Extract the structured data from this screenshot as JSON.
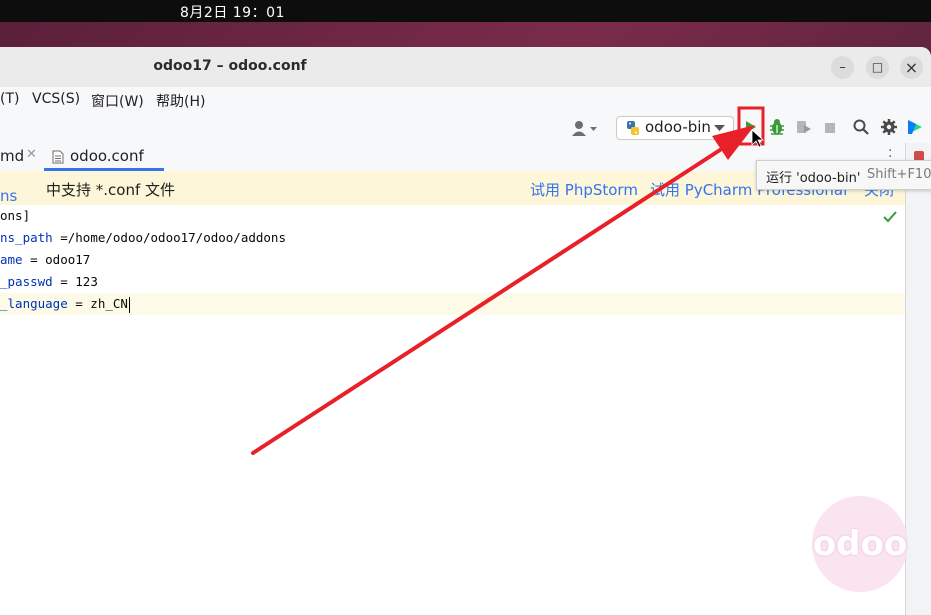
{
  "system": {
    "clock": "8月2日  19：01"
  },
  "window": {
    "title": "odoo17 – odoo.conf",
    "minimize": "–",
    "maximize": "□",
    "close": "×"
  },
  "menubar": {
    "items": [
      "(T)",
      "VCS(S)",
      "窗口(W)",
      "帮助(H)"
    ]
  },
  "toolbar": {
    "run_config": "odoo-bin"
  },
  "tabs": [
    {
      "label": "md"
    },
    {
      "label": "odoo.conf"
    }
  ],
  "banner": {
    "message_link": "ns IDE",
    "message": "中支持 *.conf 文件",
    "action1": "试用 PhpStorm",
    "action2": "试用 PyCharm Professional",
    "action3": "关闭"
  },
  "editor": {
    "lines": [
      {
        "key": "",
        "rest": "ons]"
      },
      {
        "key": "ns_path",
        "rest": " =/home/odoo/odoo17/odoo/addons"
      },
      {
        "key": "ame",
        "rest": " = odoo17"
      },
      {
        "key": "_passwd",
        "rest": " = 123"
      },
      {
        "key": "_language",
        "rest": " = zh_CN"
      }
    ]
  },
  "tooltip": {
    "text": "运行 'odoo-bin'",
    "shortcut": "Shift+F10"
  },
  "watermark": {
    "text": "odoo"
  },
  "colors": {
    "annotation_red": "#e8202a",
    "run_green": "#3a9a3a",
    "link_blue": "#3574f0"
  }
}
